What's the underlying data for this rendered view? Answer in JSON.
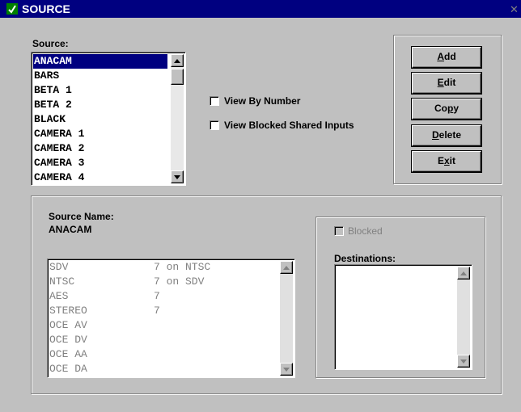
{
  "window": {
    "title": "SOURCE",
    "close_glyph": "✕"
  },
  "source_list": {
    "label": "Source:",
    "items": [
      "ANACAM",
      "BARS",
      "BETA 1",
      "BETA 2",
      "BLACK",
      "CAMERA 1",
      "CAMERA 2",
      "CAMERA 3",
      "CAMERA 4"
    ],
    "selected": "ANACAM"
  },
  "options": {
    "view_by_number": "View By Number",
    "view_blocked_shared_inputs": "View Blocked Shared Inputs"
  },
  "buttons": {
    "add": {
      "pre": "",
      "key": "A",
      "post": "dd"
    },
    "edit": {
      "pre": "",
      "key": "E",
      "post": "dit"
    },
    "copy": {
      "pre": "Co",
      "key": "p",
      "post": "y"
    },
    "delete": {
      "pre": "",
      "key": "D",
      "post": "elete"
    },
    "exit": {
      "pre": "E",
      "key": "x",
      "post": "it"
    }
  },
  "details": {
    "name_label": "Source Name:",
    "name_value": "ANACAM",
    "signals": [
      {
        "name": "SDV",
        "level": "7 on NTSC"
      },
      {
        "name": "NTSC",
        "level": "7 on SDV"
      },
      {
        "name": "AES",
        "level": "7"
      },
      {
        "name": "STEREO",
        "level": "7"
      },
      {
        "name": "OCE AV",
        "level": ""
      },
      {
        "name": "OCE DV",
        "level": ""
      },
      {
        "name": "OCE AA",
        "level": ""
      },
      {
        "name": "OCE DA",
        "level": ""
      }
    ],
    "blocked_label": "Blocked",
    "destinations_label": "Destinations:"
  },
  "colors": {
    "titlebar": "#000080",
    "selection": "#000080",
    "face": "#c0c0c0"
  }
}
